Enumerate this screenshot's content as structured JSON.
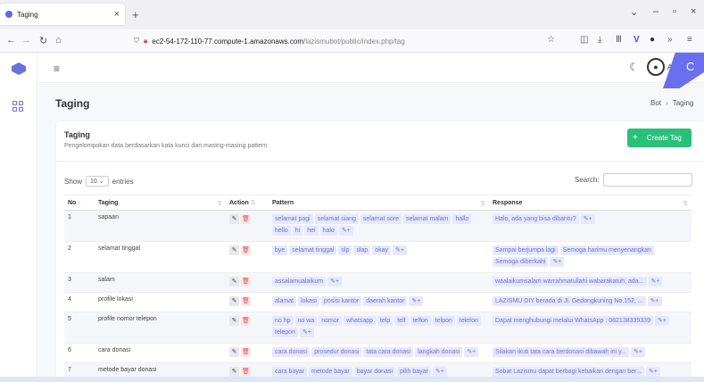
{
  "browser": {
    "tab_title": "Taging",
    "url_host": "ec2-54-172-110-77.compute-1.amazonaws.com",
    "url_path": "/lazismubot/public/index.php/tag"
  },
  "header": {
    "user": "Ad",
    "ribbon_letter": "C"
  },
  "page": {
    "title": "Taging",
    "breadcrumb": [
      "Bot",
      "Taging"
    ]
  },
  "card": {
    "title": "Taging",
    "subtitle": "Pengelompokan data berdasarkan kata kunci dari masing-masing pattern",
    "create_label": "Create Tag",
    "show_prefix": "Show",
    "show_value": "10",
    "show_suffix": "entries",
    "search_label": "Search:"
  },
  "table": {
    "columns": [
      "No",
      "Taging",
      "Action",
      "Pattern",
      "Response"
    ],
    "rows": [
      {
        "no": "1",
        "tag": "sapaan",
        "patterns": [
          "selamat pagi",
          "selamat siang",
          "selamat sore",
          "selamat malam",
          "hallo",
          "hello",
          "hi",
          "hei",
          "halo"
        ],
        "responses": [
          "Halo, ada yang bisa dibantu?"
        ]
      },
      {
        "no": "2",
        "tag": "selamat tinggal",
        "patterns": [
          "bye",
          "selamat tinggal",
          "slp",
          "slap",
          "okay"
        ],
        "responses": [
          "Sampai berjumpa lagi",
          "Semoga harimu menyenangkan",
          "Semoga diberkahi"
        ]
      },
      {
        "no": "3",
        "tag": "salam",
        "patterns": [
          "assalamualaikum"
        ],
        "responses": [
          "waalaikumsalam warrahmatullahi wabarakatuh, ada..."
        ]
      },
      {
        "no": "4",
        "tag": "profile lokasi",
        "patterns": [
          "alamat",
          "lokasi",
          "posisi kantor",
          "daerah kantor"
        ],
        "responses": [
          "LAZISMU DIY berada di Jl. Gedongkuning No.152, ..."
        ]
      },
      {
        "no": "5",
        "tag": "profile nomor telepon",
        "patterns": [
          "no hp",
          "no wa",
          "nomor",
          "whatsapp",
          "telp",
          "telf",
          "telfon",
          "telpon",
          "telefon",
          "telepon"
        ],
        "responses": [
          "Dapat menghubungi melalui WhatsApp : 082138339339"
        ]
      },
      {
        "no": "6",
        "tag": "cara donasi",
        "patterns": [
          "cara donasi",
          "prosedur donasi",
          "tata cara donasi",
          "langkah donasi"
        ],
        "responses": [
          "Silakan ikuti tata cara berdonasi dibawah ini y..."
        ]
      },
      {
        "no": "7",
        "tag": "metode bayar donasi",
        "patterns": [
          "cara bayar",
          "metode bayar",
          "bayar donasi",
          "pilih bayar"
        ],
        "responses": [
          "Sobat Lazismu dapat berbagi kebaikan dengan ber..."
        ]
      }
    ]
  }
}
